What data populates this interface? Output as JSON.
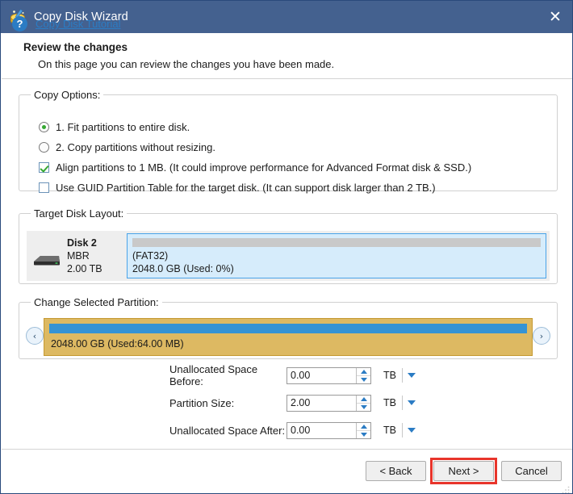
{
  "window": {
    "title": "Copy Disk Wizard",
    "title_icon": "disk-wand-icon",
    "close_label": "✕",
    "titlebar_color": "#44618f"
  },
  "header": {
    "title": "Review the changes",
    "subtitle": "On this page you can review the changes you have been made."
  },
  "copy_options": {
    "legend": "Copy Options:",
    "items": [
      {
        "type": "radio",
        "checked": true,
        "label": "1. Fit partitions to entire disk."
      },
      {
        "type": "radio",
        "checked": false,
        "label": "2. Copy partitions without resizing."
      },
      {
        "type": "checkbox",
        "checked": true,
        "label": "Align partitions to 1 MB.  (It could improve performance for Advanced Format disk & SSD.)"
      },
      {
        "type": "checkbox",
        "checked": false,
        "label": "Use GUID Partition Table for the target disk. (It can support disk larger than 2 TB.)"
      }
    ]
  },
  "target_disk_layout": {
    "legend": "Target Disk Layout:",
    "disk": {
      "name": "Disk 2",
      "scheme": "MBR",
      "size": "2.00 TB"
    },
    "partition": {
      "filesystem": "(FAT32)",
      "size_used": "2048.0 GB (Used: 0%)",
      "used_percent": 0,
      "fill_color": "#d6ecfb",
      "border_color": "#4aa3e8"
    }
  },
  "change_selected_partition": {
    "legend": "Change Selected Partition:",
    "prev_label": "‹",
    "next_label": "›",
    "partition": {
      "label": "2048.00 GB (Used:64.00 MB)",
      "fill_color": "#ddb962",
      "bar_color": "#3593d4"
    }
  },
  "size_fields": [
    {
      "label": "Unallocated Space Before:",
      "value": "0.00",
      "unit": "TB"
    },
    {
      "label": "Partition Size:",
      "value": "2.00",
      "unit": "TB"
    },
    {
      "label": "Unallocated Space After:",
      "value": "0.00",
      "unit": "TB"
    }
  ],
  "footer": {
    "help_icon": "question-mark-icon",
    "help_glyph": "?",
    "tutorial_link": "Copy Disk Tutorial",
    "buttons": {
      "back": "< Back",
      "next": "Next >",
      "cancel": "Cancel"
    },
    "highlight_color": "#e8352b"
  }
}
